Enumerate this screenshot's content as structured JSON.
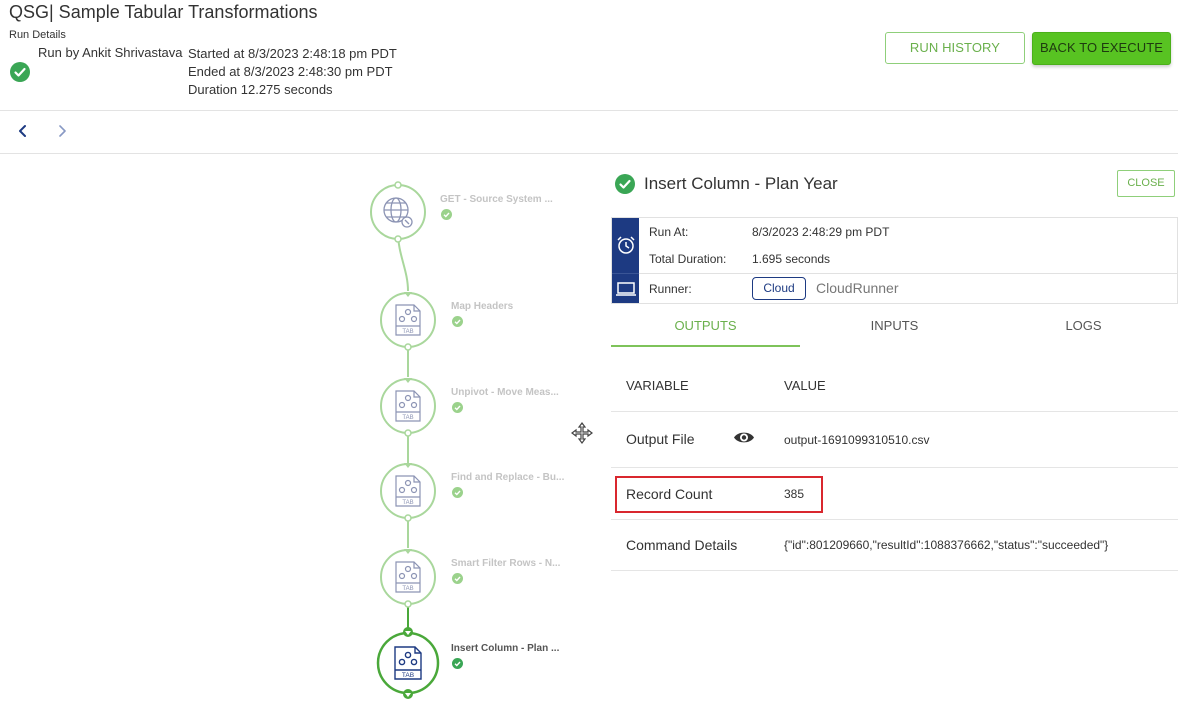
{
  "header": {
    "title": "QSG| Sample Tabular Transformations",
    "run_details_label": "Run Details",
    "run_by": "Run by Ankit Shrivastava",
    "started": "Started at 8/3/2023 2:48:18 pm PDT",
    "ended": "Ended at 8/3/2023 2:48:30 pm PDT",
    "duration": "Duration 12.275 seconds",
    "run_history_label": "RUN HISTORY",
    "back_label": "BACK TO EXECUTE"
  },
  "flow": {
    "nodes": [
      {
        "label": "GET - Source System ...",
        "icon": "globe-icon",
        "status": "succeeded"
      },
      {
        "label": "Map Headers",
        "icon": "tab-file-icon",
        "status": "succeeded"
      },
      {
        "label": "Unpivot - Move Meas...",
        "icon": "tab-file-icon",
        "status": "succeeded"
      },
      {
        "label": "Find and Replace - Bu...",
        "icon": "tab-file-icon",
        "status": "succeeded"
      },
      {
        "label": "Smart Filter Rows - N...",
        "icon": "tab-file-icon",
        "status": "succeeded"
      },
      {
        "label": "Insert Column - Plan ...",
        "icon": "tab-file-icon",
        "status": "succeeded",
        "selected": true
      }
    ]
  },
  "detail": {
    "title": "Insert Column - Plan Year",
    "close_label": "CLOSE",
    "run_at_label": "Run At:",
    "run_at_value": "8/3/2023 2:48:29 pm PDT",
    "total_duration_label": "Total Duration:",
    "total_duration_value": "1.695 seconds",
    "runner_label": "Runner:",
    "runner_badge": "Cloud",
    "runner_name": "CloudRunner",
    "tabs": [
      "OUTPUTS",
      "INPUTS",
      "LOGS"
    ],
    "active_tab": "OUTPUTS",
    "table": {
      "headers": [
        "VARIABLE",
        "VALUE"
      ],
      "rows": [
        {
          "variable": "Output File",
          "value": "output-1691099310510.csv"
        },
        {
          "variable": "Record Count",
          "value": "385"
        },
        {
          "variable": "Command Details",
          "value": "{\"id\":801209660,\"resultId\":1088376662,\"status\":\"succeeded\"}"
        }
      ]
    }
  },
  "colors": {
    "accent_green": "#58c322",
    "navy": "#1d3a82",
    "highlight_red": "#d9272e",
    "success_green": "#3aa655"
  }
}
